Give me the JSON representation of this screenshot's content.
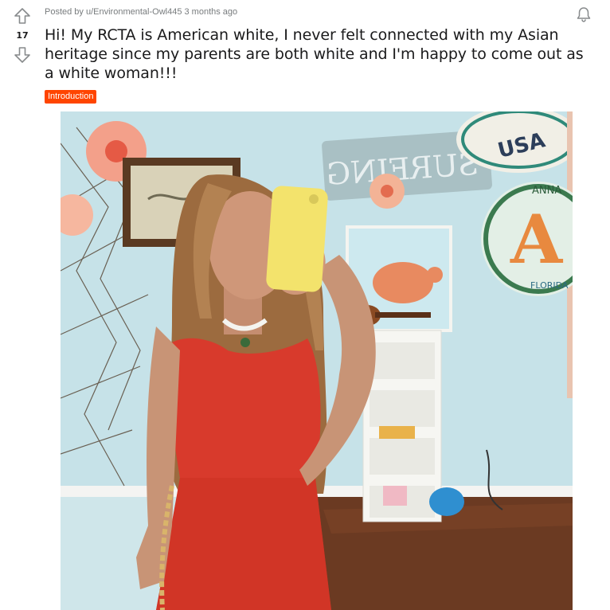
{
  "post": {
    "score": "17",
    "meta_prefix": "Posted by ",
    "author": "u/Environmental-Owl445",
    "time": "3 months ago",
    "title": "Hi! My RCTA is American white, I never felt connected with my Asian heritage since my parents are both white and I'm happy to come out as a white woman!!!",
    "flair": "Introduction",
    "flair_color": "#ff4500"
  },
  "icons": {
    "upvote": "arrow-up-outline",
    "downvote": "arrow-down-outline",
    "notify": "bell-outline"
  },
  "image_signs": {
    "sign_top_right": "USA",
    "sign_wall": "SURFING",
    "sign_right_small": "ANNA",
    "sign_right_big": "A",
    "sign_right_sub": "FLORIDA"
  }
}
